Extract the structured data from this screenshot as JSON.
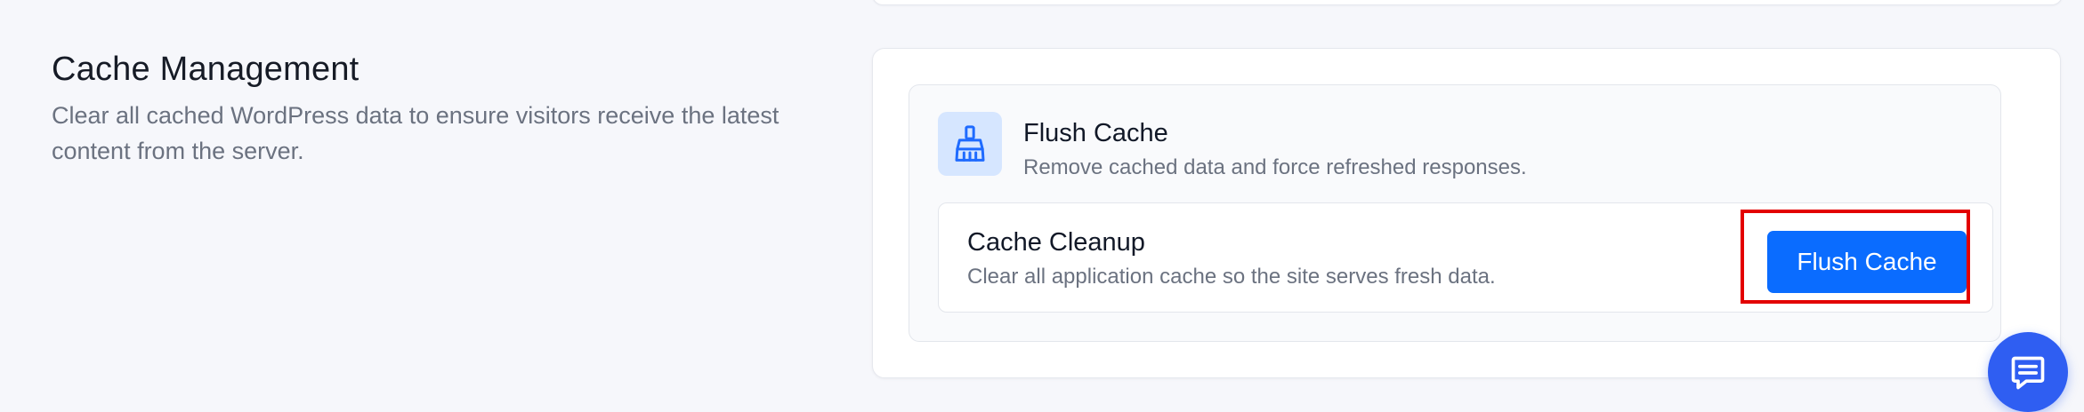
{
  "section": {
    "title": "Cache Management",
    "description": "Clear all cached WordPress data to ensure visitors receive the latest content from the server."
  },
  "card": {
    "icon": "broom-icon",
    "title": "Flush Cache",
    "description": "Remove cached data and force refreshed responses.",
    "row": {
      "title": "Cache Cleanup",
      "description": "Clear all application cache so the site serves fresh data.",
      "button_label": "Flush Cache"
    }
  },
  "chat": {
    "icon": "chat-icon"
  },
  "colors": {
    "accent": "#0a6cff",
    "icon_tile_bg": "#d6e6ff",
    "highlight": "#e30000",
    "chat_bg": "#2f5ef2"
  }
}
